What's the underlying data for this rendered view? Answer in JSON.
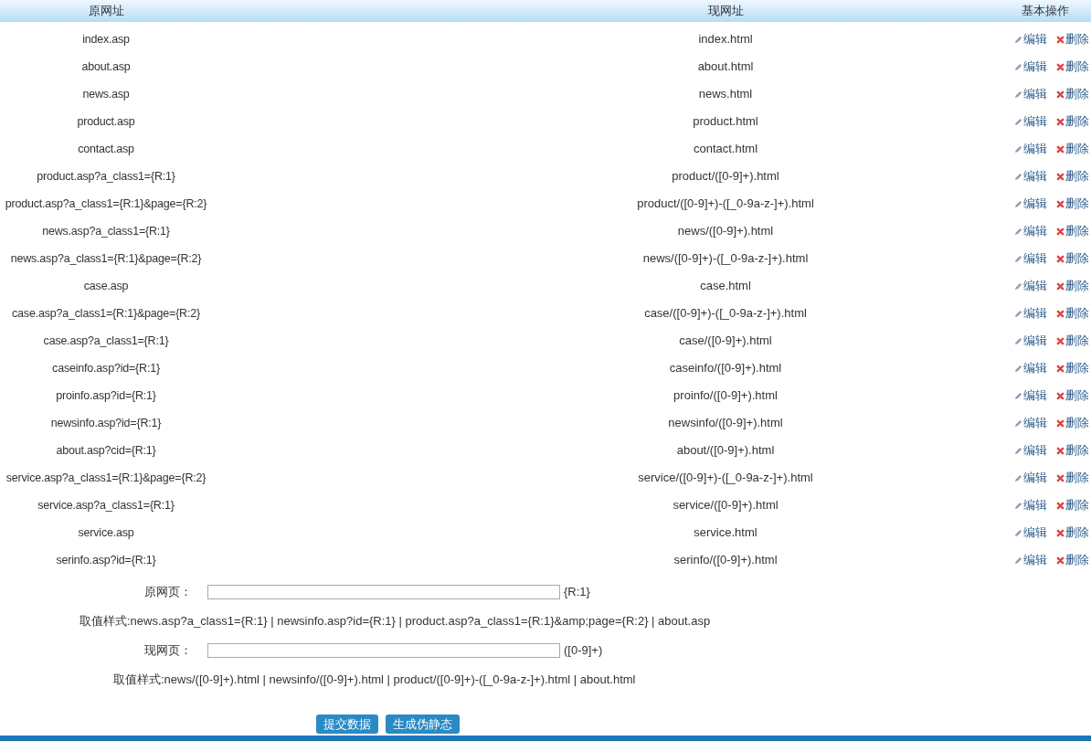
{
  "table": {
    "columns": [
      "原网址",
      "现网址",
      "基本操作"
    ],
    "rows": [
      {
        "original": "index.asp",
        "current": "index.html",
        "edit": "编辑",
        "delete": "删除"
      },
      {
        "original": "about.asp",
        "current": "about.html",
        "edit": "编辑",
        "delete": "删除"
      },
      {
        "original": "news.asp",
        "current": "news.html",
        "edit": "编辑",
        "delete": "删除"
      },
      {
        "original": "product.asp",
        "current": "product.html",
        "edit": "编辑",
        "delete": "删除"
      },
      {
        "original": "contact.asp",
        "current": "contact.html",
        "edit": "编辑",
        "delete": "删除"
      },
      {
        "original": "product.asp?a_class1={R:1}",
        "current": "product/([0-9]+).html",
        "edit": "编辑",
        "delete": "删除"
      },
      {
        "original": "product.asp?a_class1={R:1}&page={R:2}",
        "current": "product/([0-9]+)-([_0-9a-z-]+).html",
        "edit": "编辑",
        "delete": "删除"
      },
      {
        "original": "news.asp?a_class1={R:1}",
        "current": "news/([0-9]+).html",
        "edit": "编辑",
        "delete": "删除"
      },
      {
        "original": "news.asp?a_class1={R:1}&page={R:2}",
        "current": "news/([0-9]+)-([_0-9a-z-]+).html",
        "edit": "编辑",
        "delete": "删除"
      },
      {
        "original": "case.asp",
        "current": "case.html",
        "edit": "编辑",
        "delete": "删除"
      },
      {
        "original": "case.asp?a_class1={R:1}&page={R:2}",
        "current": "case/([0-9]+)-([_0-9a-z-]+).html",
        "edit": "编辑",
        "delete": "删除"
      },
      {
        "original": "case.asp?a_class1={R:1}",
        "current": "case/([0-9]+).html",
        "edit": "编辑",
        "delete": "删除"
      },
      {
        "original": "caseinfo.asp?id={R:1}",
        "current": "caseinfo/([0-9]+).html",
        "edit": "编辑",
        "delete": "删除"
      },
      {
        "original": "proinfo.asp?id={R:1}",
        "current": "proinfo/([0-9]+).html",
        "edit": "编辑",
        "delete": "删除"
      },
      {
        "original": "newsinfo.asp?id={R:1}",
        "current": "newsinfo/([0-9]+).html",
        "edit": "编辑",
        "delete": "删除"
      },
      {
        "original": "about.asp?cid={R:1}",
        "current": "about/([0-9]+).html",
        "edit": "编辑",
        "delete": "删除"
      },
      {
        "original": "service.asp?a_class1={R:1}&page={R:2}",
        "current": "service/([0-9]+)-([_0-9a-z-]+).html",
        "edit": "编辑",
        "delete": "删除"
      },
      {
        "original": "service.asp?a_class1={R:1}",
        "current": "service/([0-9]+).html",
        "edit": "编辑",
        "delete": "删除"
      },
      {
        "original": "service.asp",
        "current": "service.html",
        "edit": "编辑",
        "delete": "删除"
      },
      {
        "original": "serinfo.asp?id={R:1}",
        "current": "serinfo/([0-9]+).html",
        "edit": "编辑",
        "delete": "删除"
      }
    ]
  },
  "form": {
    "fields": [
      {
        "label": "原网页：",
        "suffix": "{R:1}",
        "hint": "取值样式:news.asp?a_class1={R:1} | newsinfo.asp?id={R:1} | product.asp?a_class1={R:1}&amp;page={R:2} | about.asp"
      },
      {
        "label": "现网页：",
        "suffix": "([0-9]+)",
        "hint": "取值样式:news/([0-9]+).html | newsinfo/([0-9]+).html | product/([0-9]+)-([_0-9a-z-]+).html | about.html"
      }
    ],
    "buttons": [
      "提交数据",
      "生成伪静态"
    ]
  }
}
